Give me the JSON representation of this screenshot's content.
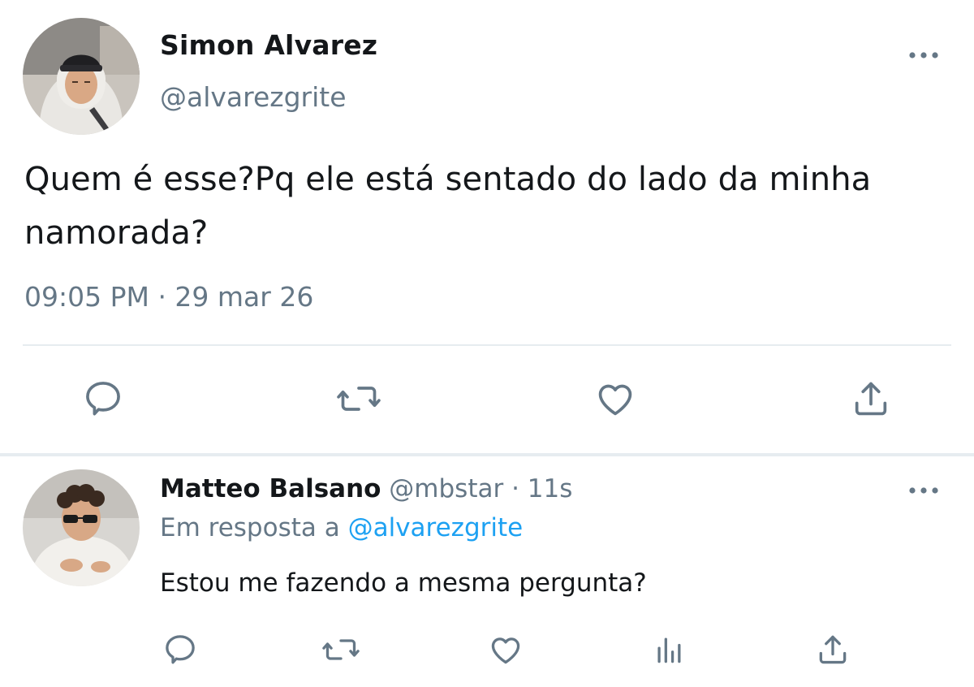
{
  "main_tweet": {
    "author_name": "Simon Alvarez",
    "author_handle": "@alvarezgrite",
    "text": "Quem é esse?Pq ele está sentado do lado da minha namorada?",
    "timestamp": "09:05 PM · 29 mar 26",
    "actions": [
      "reply-icon",
      "retweet-icon",
      "like-icon",
      "share-icon"
    ]
  },
  "reply": {
    "author_name": "Matteo Balsano",
    "author_handle": "@mbstar",
    "separator": " · ",
    "time_ago": "11s",
    "reply_to_prefix": "Em resposta a ",
    "reply_to_handle": "@alvarezgrite",
    "text": "Estou me fazendo a mesma pergunta?",
    "actions": [
      "reply-icon",
      "retweet-icon",
      "like-icon",
      "analytics-icon",
      "share-icon"
    ]
  },
  "colors": {
    "text_primary": "#14171a",
    "text_secondary": "#657786",
    "link": "#1da1f2",
    "divider": "#e6ecf0"
  }
}
